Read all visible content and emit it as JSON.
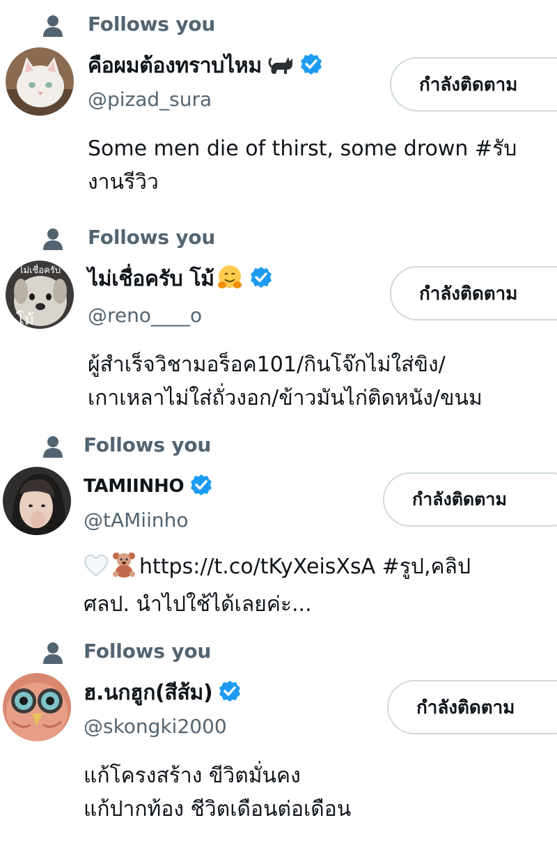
{
  "follows_you_label": "Follows you",
  "follow_button_label": "กำลังติดตาม",
  "users": [
    {
      "display_name": "คือผมต้องทราบไหม",
      "emoji": "black-cat",
      "verified": true,
      "handle": "@pizad_sura",
      "bio_lines": [
        "Some men die of thirst, some drown #รับ",
        "งานรีวิว"
      ]
    },
    {
      "display_name": "ไม่เชื่อครับ โม้",
      "emoji": "hugging-face",
      "verified": true,
      "handle": "@reno____o",
      "avatar_caption_top": "ไม่เชื่อครับ",
      "avatar_caption_bottom": "โม้",
      "bio_lines": [
        "ผู้สำเร็จวิชามอร็อค101/กินโจ๊กไม่ใส่ขิง/",
        "เกาเหลาไม่ใส่ถั่วงอก/ข้าวมันไก่ติดหนัง/ขนม"
      ]
    },
    {
      "display_name": "TAMIINHO",
      "verified": true,
      "handle": "@tAMiinho",
      "bio_emojis": [
        "white-heart",
        "teddy-bear"
      ],
      "bio_lines": [
        "https://t.co/tKyXeisXsA  #รูป,คลิป",
        "ศลป. นำไปใช้ได้เลยค่ะ..."
      ]
    },
    {
      "display_name": "ฮ.นกฮูก(สีส้ม)",
      "verified": true,
      "handle": "@skongki2000",
      "bio_lines": [
        "แก้โครงสร้าง ขีวิตมั่นคง",
        "แก้ปากท้อง ชีวิตเดือนต่อเดือน"
      ]
    }
  ],
  "colors": {
    "verified_blue": "#1d9bf0",
    "secondary_text": "#536471",
    "primary_text": "#0f1419",
    "button_border": "#cfd9de"
  }
}
